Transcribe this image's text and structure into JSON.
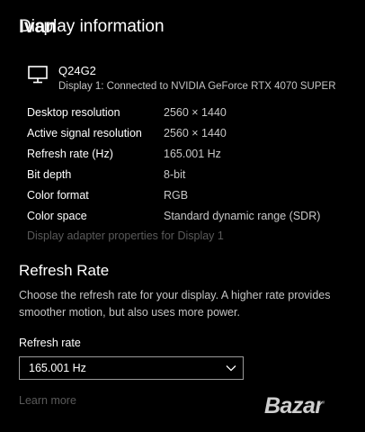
{
  "header": {
    "title": "Display information",
    "overlay_text": "Ivan"
  },
  "monitor": {
    "icon": "monitor-icon",
    "name": "Q24G2",
    "connection": "Display 1: Connected to NVIDIA GeForce RTX 4070 SUPER"
  },
  "info": [
    {
      "label": "Desktop resolution",
      "value": "2560 × 1440"
    },
    {
      "label": "Active signal resolution",
      "value": "2560 × 1440"
    },
    {
      "label": "Refresh rate (Hz)",
      "value": "165.001 Hz"
    },
    {
      "label": "Bit depth",
      "value": "8-bit"
    },
    {
      "label": "Color format",
      "value": "RGB"
    },
    {
      "label": "Color space",
      "value": "Standard dynamic range (SDR)"
    }
  ],
  "adapter_link": "Display adapter properties for Display 1",
  "refresh_section": {
    "title": "Refresh Rate",
    "description": "Choose the refresh rate for your display. A higher rate provides smoother motion, but also uses more power.",
    "dropdown_label": "Refresh rate",
    "selected": "165.001 Hz",
    "learn_more": "Learn more"
  },
  "watermark": {
    "text": "Bazar"
  },
  "colors": {
    "background": "#000000",
    "text": "#ffffff",
    "secondary_text": "#c8c8c8",
    "disabled_link": "#5a5a5a",
    "dropdown_border": "#9a9a9a"
  }
}
